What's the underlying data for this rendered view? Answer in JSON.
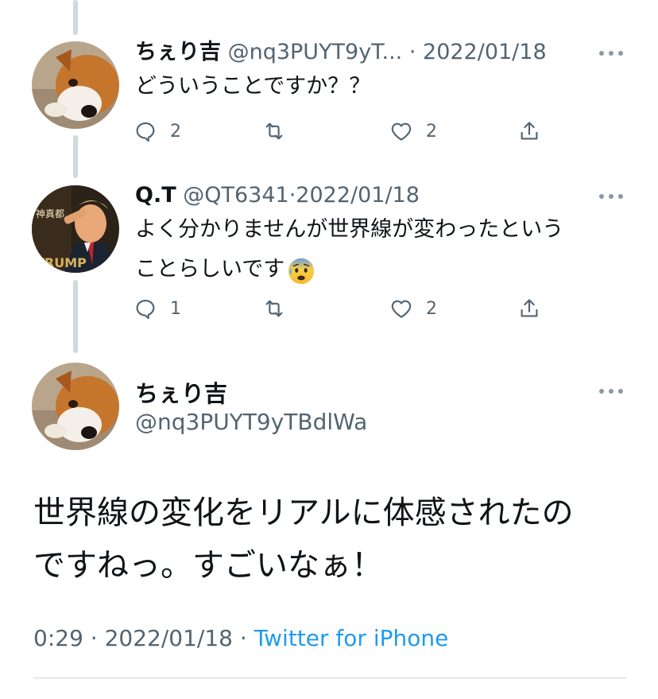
{
  "tweets": [
    {
      "name": "ちぇり吉",
      "handle": "@nq3PUYT9yT...",
      "sep": " · ",
      "date": "2022/01/18",
      "text": "どういうことですか？？",
      "avatar": "shiba-dog-photo",
      "replies": "2",
      "retweets": "",
      "likes": "2"
    },
    {
      "name": "Q.T",
      "handle": "@QT6341",
      "sep": "·",
      "date": "2022/01/18",
      "text_line1": "よく分かりませんが世界線が変わったという",
      "text_line2": "ことらしいです",
      "emoji": "anxious-face-with-sweat",
      "avatar": "trump-saluting-photo",
      "avatar_text_top": "神真都",
      "avatar_text_bottom": "TRUMP",
      "replies": "1",
      "retweets": "",
      "likes": "2"
    }
  ],
  "focus": {
    "name": "ちぇり吉",
    "handle": "@nq3PUYT9yTBdlWa",
    "text_line1": "世界線の変化をリアルに体感されたの",
    "text_line2": "ですねっ。すごいなぁ！",
    "time": "0:29",
    "sep": " · ",
    "date": "2022/01/18",
    "sep2": " · ",
    "source": "Twitter for iPhone"
  },
  "colors": {
    "thread_line": "#cfd9de",
    "secondary_text": "#536471",
    "link": "#1d9bf0"
  }
}
